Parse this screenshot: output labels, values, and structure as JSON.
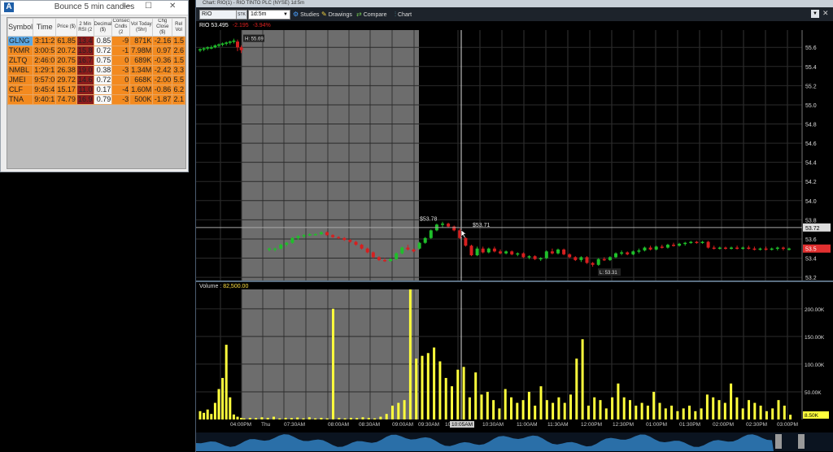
{
  "scanner": {
    "logo": "A",
    "title": "Bounce 5 min candles",
    "controls": {
      "minimize": "—",
      "maximize": "☐",
      "close": "✕"
    },
    "columns": [
      "Symbol",
      "Time",
      "Price ($)",
      "2 Min RSI (2",
      "Decimal ($)",
      "Consec Cndls (2",
      "Vol Today (Shr)",
      "Chg Close ($)",
      "Rel Vol"
    ],
    "rows": [
      {
        "symbol": "GLNG",
        "time": "3:11:2",
        "price": "61.85",
        "rsi": "13.4",
        "decimal": "0.85",
        "consec": "-9",
        "vol": "871K",
        "chg": "-2.16",
        "rel": "1.5"
      },
      {
        "symbol": "TKMR",
        "time": "3:00:5",
        "price": "20.72",
        "rsi": "15.8",
        "decimal": "0.72",
        "consec": "-1",
        "vol": "7.98M",
        "chg": "0.97",
        "rel": "2.6"
      },
      {
        "symbol": "ZLTQ",
        "time": "2:46:0",
        "price": "20.75",
        "rsi": "16.7",
        "decimal": "0.75",
        "consec": "0",
        "vol": "689K",
        "chg": "-0.36",
        "rel": "1.5"
      },
      {
        "symbol": "NMBL",
        "time": "1:29:1",
        "price": "26.38",
        "rsi": "19.0",
        "decimal": "0.38",
        "consec": "-3",
        "vol": "1.34M",
        "chg": "-2.42",
        "rel": "3.3"
      },
      {
        "symbol": "JMEI",
        "time": "9:57:0",
        "price": "29.72",
        "rsi": "14.6",
        "decimal": "0.72",
        "consec": "0",
        "vol": "668K",
        "chg": "-2.00",
        "rel": "5.5"
      },
      {
        "symbol": "CLF",
        "time": "9:45:4",
        "price": "15.17",
        "rsi": "11.0",
        "decimal": "0.17",
        "consec": "-4",
        "vol": "1.60M",
        "chg": "-0.86",
        "rel": "6.2"
      },
      {
        "symbol": "TNA",
        "time": "9:40:1",
        "price": "74.79",
        "rsi": "16.9",
        "decimal": "0.79",
        "consec": "-3",
        "vol": "500K",
        "chg": "-1.87",
        "rel": "2.1"
      }
    ]
  },
  "chart_window": {
    "title": "Chart: RIO(1) - RIO TINTO PLC (NYSE) 1d:5m",
    "symbol": "RIO",
    "link_label": "STK",
    "interval": "1d:5m",
    "toolbar": {
      "studies": "Studies",
      "drawings": "Drawings",
      "compare": "Compare",
      "chart": "Chart"
    },
    "price_header": {
      "symbol": "RIO",
      "last": "53.495",
      "change": "-2.195",
      "change_pct": "-3.94%"
    },
    "volume_header": {
      "label": "Volume",
      "value": "82,500.00"
    },
    "colors": {
      "up": "#1fbf2a",
      "down": "#d61f1f",
      "volume": "#ffff3c",
      "premarket_shade": "#6d6d6d"
    }
  },
  "chart_data": [
    {
      "type": "candlestick",
      "series": "price",
      "yticks": [
        53.2,
        53.4,
        53.6,
        53.8,
        54.0,
        54.2,
        54.4,
        54.6,
        54.8,
        55.0,
        55.2,
        55.4,
        55.6
      ],
      "ylim": [
        53.15,
        55.78
      ],
      "xticks": [
        "04:00PM",
        "Thu",
        "07:30AM",
        "08:00AM",
        "08:30AM",
        "09:00AM",
        "09:30AM",
        "10:00AM",
        "10:30AM",
        "11:00AM",
        "11:30AM",
        "12:00PM",
        "12:30PM",
        "01:00PM",
        "01:30PM",
        "02:00PM",
        "02:30PM",
        "03:00PM"
      ],
      "crosshair_x_label": "10:05AM",
      "axis_badges": {
        "crosshair_price": "53.72",
        "last_price": "53.5"
      },
      "annotations": [
        {
          "label": "H: 55.69",
          "price": 55.69
        },
        {
          "label": "$53.78",
          "price": 53.78
        },
        {
          "label": "$53.71",
          "price": 53.71
        },
        {
          "label": "L: 53.31",
          "price": 53.31
        }
      ],
      "premarket_shaded": true,
      "candles": [
        {
          "o": 55.57,
          "h": 55.59,
          "l": 55.55,
          "c": 55.58
        },
        {
          "o": 55.58,
          "h": 55.6,
          "l": 55.56,
          "c": 55.59
        },
        {
          "o": 55.59,
          "h": 55.61,
          "l": 55.57,
          "c": 55.6
        },
        {
          "o": 55.6,
          "h": 55.62,
          "l": 55.58,
          "c": 55.6
        },
        {
          "o": 55.6,
          "h": 55.63,
          "l": 55.59,
          "c": 55.62
        },
        {
          "o": 55.62,
          "h": 55.64,
          "l": 55.6,
          "c": 55.63
        },
        {
          "o": 55.63,
          "h": 55.65,
          "l": 55.61,
          "c": 55.64
        },
        {
          "o": 55.64,
          "h": 55.66,
          "l": 55.62,
          "c": 55.65
        },
        {
          "o": 55.65,
          "h": 55.67,
          "l": 55.63,
          "c": 55.66
        },
        {
          "o": 55.66,
          "h": 55.69,
          "l": 55.64,
          "c": 55.67
        },
        {
          "o": 55.66,
          "h": 55.68,
          "l": 55.56,
          "c": 55.6
        },
        {
          "o": 55.6,
          "h": 55.62,
          "l": 55.54,
          "c": 55.57
        },
        {
          "o": 53.49,
          "h": 53.51,
          "l": 53.47,
          "c": 53.5
        },
        {
          "o": 53.49,
          "h": 53.51,
          "l": 53.47,
          "c": 53.5
        },
        {
          "o": 53.5,
          "h": 53.55,
          "l": 53.49,
          "c": 53.54
        },
        {
          "o": 53.54,
          "h": 53.57,
          "l": 53.52,
          "c": 53.56
        },
        {
          "o": 53.56,
          "h": 53.62,
          "l": 53.55,
          "c": 53.61
        },
        {
          "o": 53.61,
          "h": 53.64,
          "l": 53.59,
          "c": 53.63
        },
        {
          "o": 53.63,
          "h": 53.65,
          "l": 53.61,
          "c": 53.64
        },
        {
          "o": 53.64,
          "h": 53.66,
          "l": 53.63,
          "c": 53.65
        },
        {
          "o": 53.65,
          "h": 53.66,
          "l": 53.64,
          "c": 53.65
        },
        {
          "o": 53.65,
          "h": 53.68,
          "l": 53.64,
          "c": 53.67
        },
        {
          "o": 53.67,
          "h": 53.68,
          "l": 53.63,
          "c": 53.64
        },
        {
          "o": 53.64,
          "h": 53.65,
          "l": 53.61,
          "c": 53.62
        },
        {
          "o": 53.62,
          "h": 53.63,
          "l": 53.6,
          "c": 53.61
        },
        {
          "o": 53.61,
          "h": 53.62,
          "l": 53.58,
          "c": 53.59
        },
        {
          "o": 53.59,
          "h": 53.6,
          "l": 53.56,
          "c": 53.57
        },
        {
          "o": 53.57,
          "h": 53.58,
          "l": 53.53,
          "c": 53.54
        },
        {
          "o": 53.54,
          "h": 53.55,
          "l": 53.49,
          "c": 53.5
        },
        {
          "o": 53.5,
          "h": 53.51,
          "l": 53.45,
          "c": 53.46
        },
        {
          "o": 53.46,
          "h": 53.47,
          "l": 53.4,
          "c": 53.41
        },
        {
          "o": 53.41,
          "h": 53.42,
          "l": 53.37,
          "c": 53.38
        },
        {
          "o": 53.38,
          "h": 53.4,
          "l": 53.36,
          "c": 53.37
        },
        {
          "o": 53.37,
          "h": 53.4,
          "l": 53.36,
          "c": 53.39
        },
        {
          "o": 53.39,
          "h": 53.46,
          "l": 53.38,
          "c": 53.45
        },
        {
          "o": 53.45,
          "h": 53.52,
          "l": 53.44,
          "c": 53.51
        },
        {
          "o": 53.51,
          "h": 53.54,
          "l": 53.48,
          "c": 53.49
        },
        {
          "o": 53.49,
          "h": 53.5,
          "l": 53.46,
          "c": 53.47
        },
        {
          "o": 53.5,
          "h": 53.57,
          "l": 53.49,
          "c": 53.56
        },
        {
          "o": 53.56,
          "h": 53.62,
          "l": 53.55,
          "c": 53.61
        },
        {
          "o": 53.61,
          "h": 53.7,
          "l": 53.6,
          "c": 53.69
        },
        {
          "o": 53.69,
          "h": 53.76,
          "l": 53.68,
          "c": 53.75
        },
        {
          "o": 53.75,
          "h": 53.78,
          "l": 53.72,
          "c": 53.76
        },
        {
          "o": 53.76,
          "h": 53.77,
          "l": 53.72,
          "c": 53.73
        },
        {
          "o": 53.73,
          "h": 53.74,
          "l": 53.68,
          "c": 53.69
        },
        {
          "o": 53.69,
          "h": 53.71,
          "l": 53.6,
          "c": 53.61
        },
        {
          "o": 53.61,
          "h": 53.62,
          "l": 53.52,
          "c": 53.53
        },
        {
          "o": 53.53,
          "h": 53.54,
          "l": 53.42,
          "c": 53.43
        },
        {
          "o": 53.43,
          "h": 53.52,
          "l": 53.42,
          "c": 53.5
        },
        {
          "o": 53.5,
          "h": 53.52,
          "l": 53.45,
          "c": 53.46
        },
        {
          "o": 53.46,
          "h": 53.51,
          "l": 53.45,
          "c": 53.5
        },
        {
          "o": 53.5,
          "h": 53.52,
          "l": 53.46,
          "c": 53.47
        },
        {
          "o": 53.47,
          "h": 53.49,
          "l": 53.44,
          "c": 53.45
        },
        {
          "o": 53.45,
          "h": 53.48,
          "l": 53.44,
          "c": 53.47
        },
        {
          "o": 53.47,
          "h": 53.48,
          "l": 53.43,
          "c": 53.44
        },
        {
          "o": 53.44,
          "h": 53.46,
          "l": 53.42,
          "c": 53.45
        },
        {
          "o": 53.45,
          "h": 53.46,
          "l": 53.4,
          "c": 53.41
        },
        {
          "o": 53.41,
          "h": 53.43,
          "l": 53.39,
          "c": 53.42
        },
        {
          "o": 53.42,
          "h": 53.43,
          "l": 53.38,
          "c": 53.39
        },
        {
          "o": 53.39,
          "h": 53.41,
          "l": 53.37,
          "c": 53.4
        },
        {
          "o": 53.4,
          "h": 53.48,
          "l": 53.39,
          "c": 53.47
        },
        {
          "o": 53.47,
          "h": 53.5,
          "l": 53.44,
          "c": 53.45
        },
        {
          "o": 53.45,
          "h": 53.5,
          "l": 53.44,
          "c": 53.49
        },
        {
          "o": 53.49,
          "h": 53.5,
          "l": 53.43,
          "c": 53.44
        },
        {
          "o": 53.44,
          "h": 53.45,
          "l": 53.4,
          "c": 53.41
        },
        {
          "o": 53.41,
          "h": 53.42,
          "l": 53.37,
          "c": 53.38
        },
        {
          "o": 53.38,
          "h": 53.42,
          "l": 53.36,
          "c": 53.41
        },
        {
          "o": 53.41,
          "h": 53.42,
          "l": 53.34,
          "c": 53.35
        },
        {
          "o": 53.35,
          "h": 53.36,
          "l": 53.31,
          "c": 53.33
        },
        {
          "o": 53.33,
          "h": 53.4,
          "l": 53.32,
          "c": 53.39
        },
        {
          "o": 53.39,
          "h": 53.41,
          "l": 53.37,
          "c": 53.38
        },
        {
          "o": 53.38,
          "h": 53.42,
          "l": 53.37,
          "c": 53.41
        },
        {
          "o": 53.41,
          "h": 53.46,
          "l": 53.4,
          "c": 53.45
        },
        {
          "o": 53.45,
          "h": 53.48,
          "l": 53.43,
          "c": 53.46
        },
        {
          "o": 53.46,
          "h": 53.47,
          "l": 53.43,
          "c": 53.44
        },
        {
          "o": 53.44,
          "h": 53.48,
          "l": 53.43,
          "c": 53.47
        },
        {
          "o": 53.47,
          "h": 53.5,
          "l": 53.45,
          "c": 53.48
        },
        {
          "o": 53.48,
          "h": 53.52,
          "l": 53.47,
          "c": 53.51
        },
        {
          "o": 53.51,
          "h": 53.53,
          "l": 53.48,
          "c": 53.49
        },
        {
          "o": 53.49,
          "h": 53.53,
          "l": 53.48,
          "c": 53.52
        },
        {
          "o": 53.52,
          "h": 53.54,
          "l": 53.5,
          "c": 53.51
        },
        {
          "o": 53.51,
          "h": 53.55,
          "l": 53.5,
          "c": 53.54
        },
        {
          "o": 53.54,
          "h": 53.56,
          "l": 53.52,
          "c": 53.53
        },
        {
          "o": 53.53,
          "h": 53.56,
          "l": 53.52,
          "c": 53.55
        },
        {
          "o": 53.55,
          "h": 53.57,
          "l": 53.53,
          "c": 53.56
        },
        {
          "o": 53.56,
          "h": 53.58,
          "l": 53.55,
          "c": 53.57
        },
        {
          "o": 53.57,
          "h": 53.58,
          "l": 53.55,
          "c": 53.56
        },
        {
          "o": 53.56,
          "h": 53.58,
          "l": 53.55,
          "c": 53.57
        },
        {
          "o": 53.57,
          "h": 53.58,
          "l": 53.5,
          "c": 53.51
        },
        {
          "o": 53.51,
          "h": 53.53,
          "l": 53.49,
          "c": 53.5
        },
        {
          "o": 53.5,
          "h": 53.52,
          "l": 53.49,
          "c": 53.51
        },
        {
          "o": 53.51,
          "h": 53.52,
          "l": 53.49,
          "c": 53.5
        },
        {
          "o": 53.5,
          "h": 53.52,
          "l": 53.49,
          "c": 53.51
        },
        {
          "o": 53.51,
          "h": 53.53,
          "l": 53.49,
          "c": 53.5
        },
        {
          "o": 53.5,
          "h": 53.52,
          "l": 53.49,
          "c": 53.51
        },
        {
          "o": 53.51,
          "h": 53.53,
          "l": 53.49,
          "c": 53.5
        },
        {
          "o": 53.5,
          "h": 53.52,
          "l": 53.48,
          "c": 53.49
        },
        {
          "o": 53.49,
          "h": 53.51,
          "l": 53.48,
          "c": 53.5
        },
        {
          "o": 53.5,
          "h": 53.52,
          "l": 53.48,
          "c": 53.49
        },
        {
          "o": 53.49,
          "h": 53.51,
          "l": 53.48,
          "c": 53.5
        },
        {
          "o": 53.5,
          "h": 53.52,
          "l": 53.48,
          "c": 53.51
        },
        {
          "o": 53.51,
          "h": 53.52,
          "l": 53.48,
          "c": 53.5
        },
        {
          "o": 53.5,
          "h": 53.51,
          "l": 53.48,
          "c": 53.5
        }
      ]
    },
    {
      "type": "bar",
      "series": "volume",
      "yticks": [
        "50.00K",
        "100.00K",
        "150.00K",
        "200.00K"
      ],
      "ylim": [
        0,
        235000
      ],
      "last_label": "8.50K",
      "values": [
        15000,
        12000,
        18000,
        10000,
        30000,
        55000,
        75000,
        135000,
        40000,
        9000,
        5000,
        3000,
        2000,
        3000,
        2500,
        4000,
        3000,
        5000,
        2000,
        3000,
        2500,
        3500,
        2000,
        4000,
        2000,
        3000,
        2000,
        200000,
        3000,
        2000,
        3000,
        2500,
        4000,
        3000,
        2000,
        5000,
        10000,
        25000,
        30000,
        35000,
        235000,
        110000,
        115000,
        120000,
        130000,
        105000,
        75000,
        60000,
        90000,
        95000,
        40000,
        85000,
        45000,
        50000,
        35000,
        20000,
        55000,
        40000,
        30000,
        35000,
        50000,
        25000,
        60000,
        35000,
        30000,
        40000,
        30000,
        45000,
        110000,
        145000,
        25000,
        40000,
        35000,
        20000,
        40000,
        65000,
        40000,
        35000,
        25000,
        30000,
        25000,
        50000,
        30000,
        20000,
        25000,
        15000,
        20000,
        25000,
        15000,
        20000,
        45000,
        40000,
        35000,
        30000,
        65000,
        40000,
        20000,
        35000,
        30000,
        25000,
        15000,
        20000,
        35000,
        25000,
        8500
      ]
    }
  ]
}
